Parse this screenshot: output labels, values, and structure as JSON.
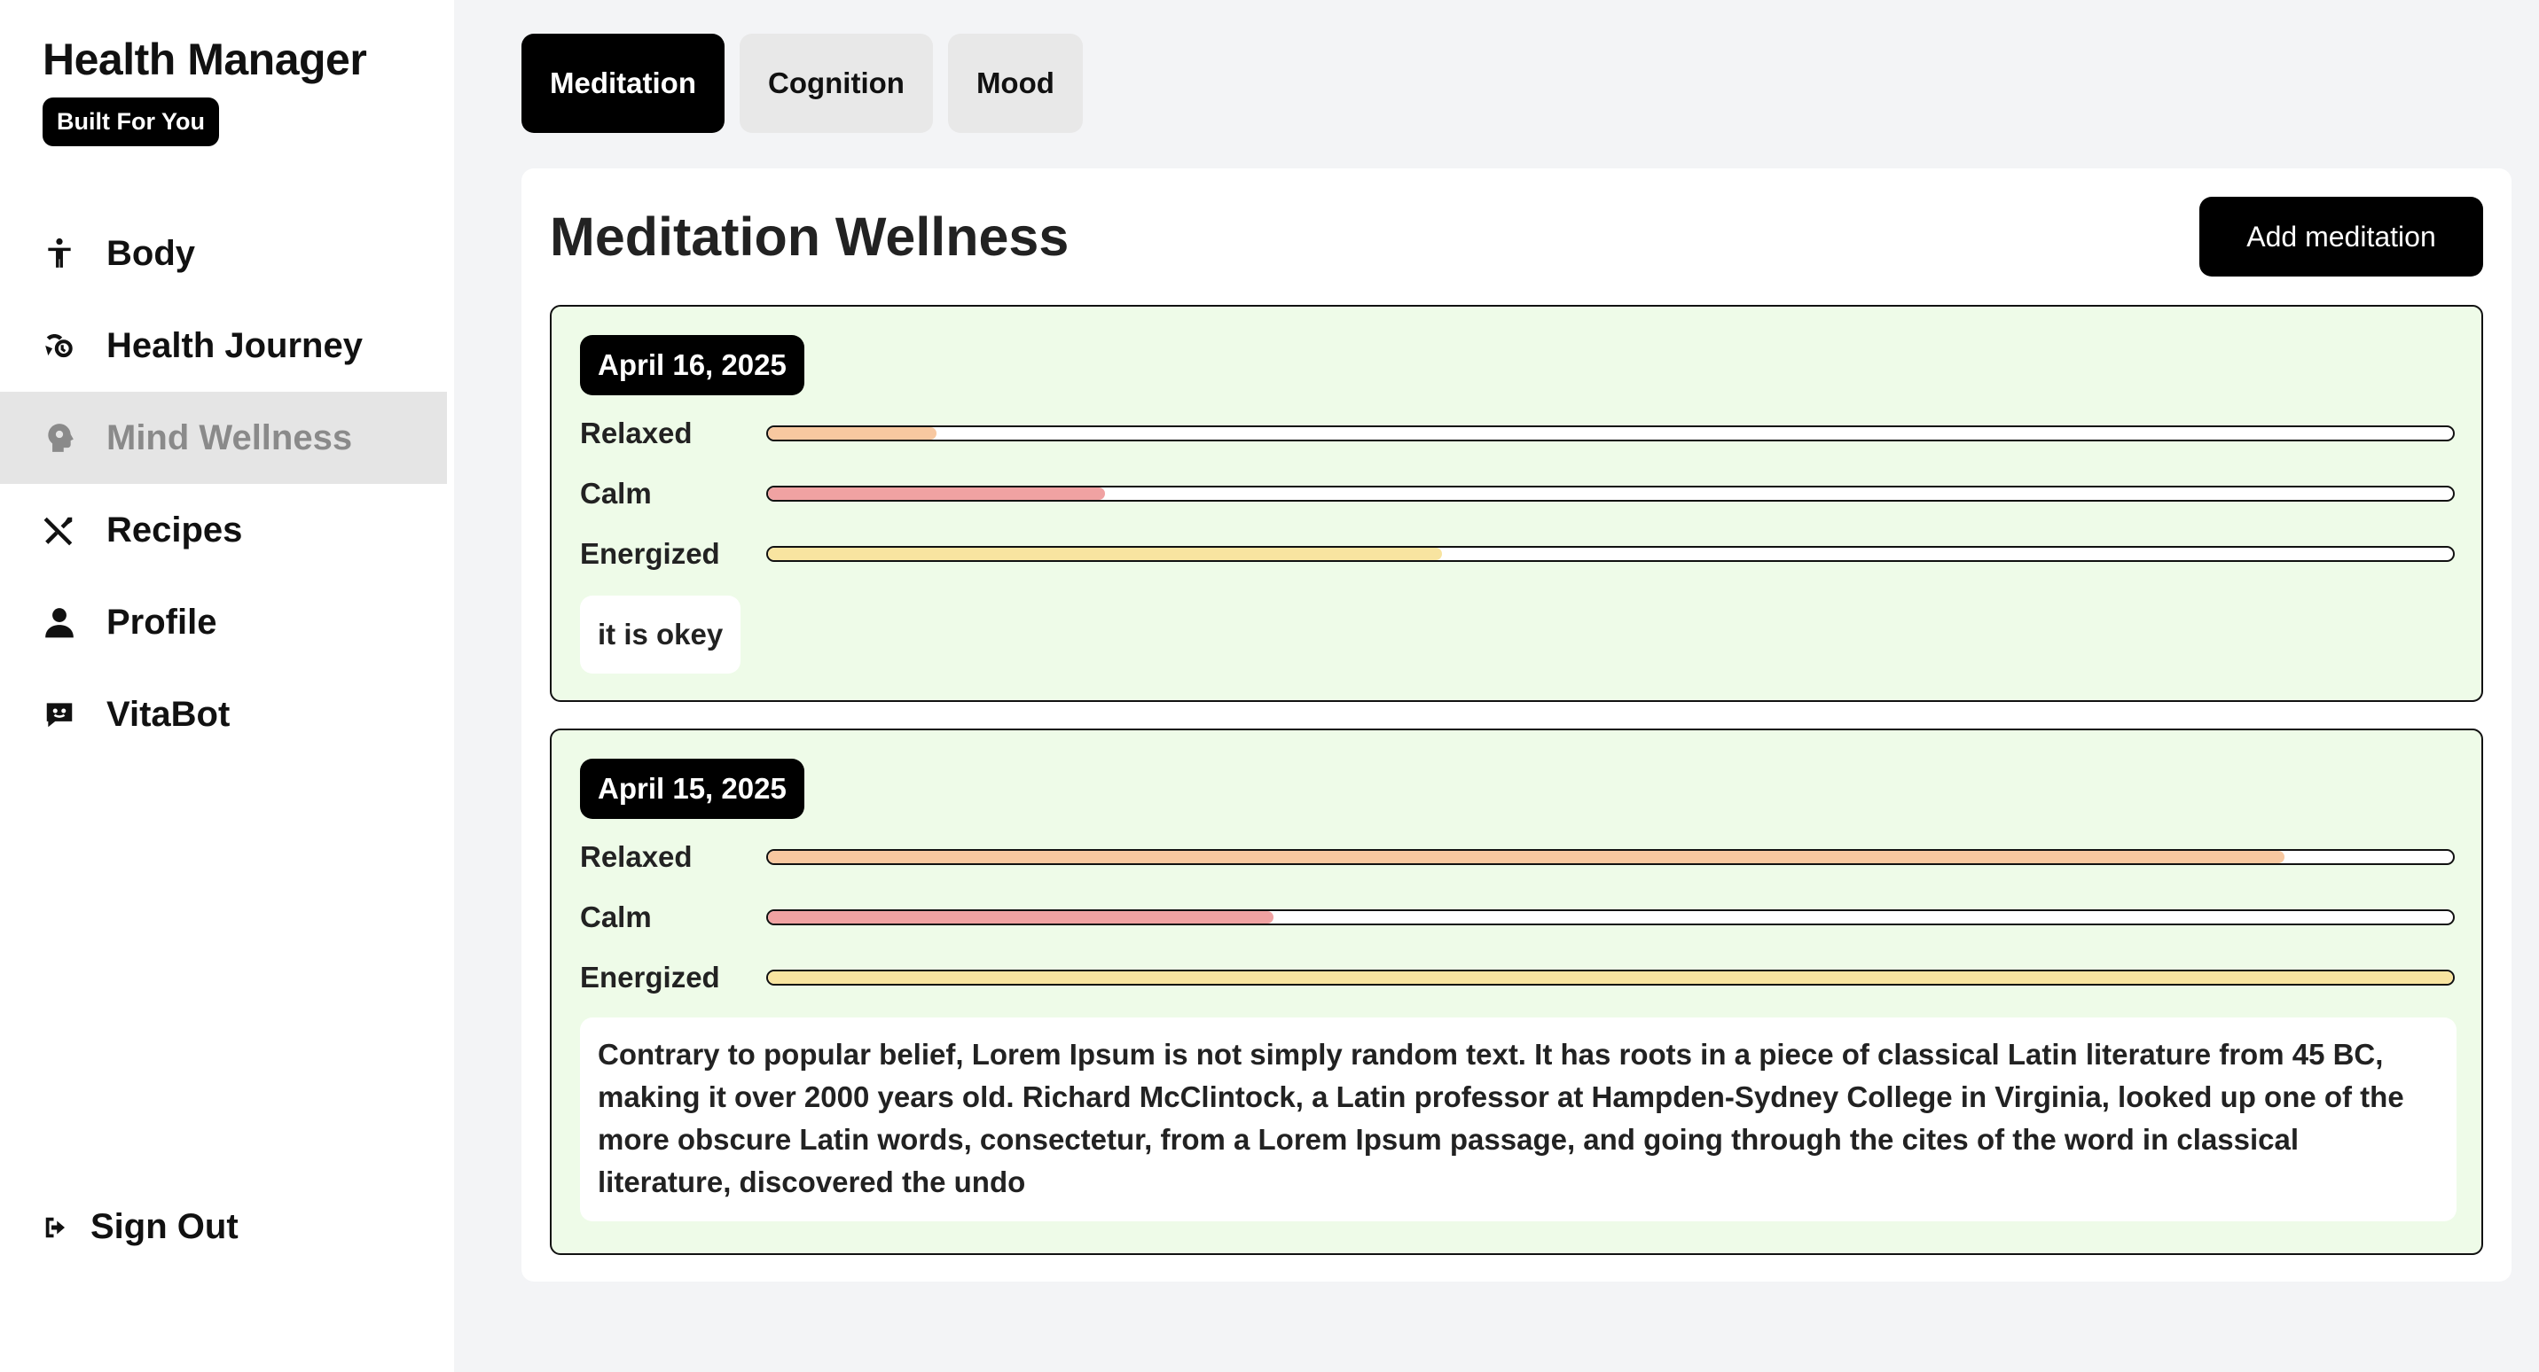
{
  "sidebar": {
    "title": "Health Manager",
    "badge": "Built For You",
    "items": [
      {
        "label": "Body",
        "icon": "person-icon"
      },
      {
        "label": "Health Journey",
        "icon": "journey-icon"
      },
      {
        "label": "Mind Wellness",
        "icon": "brain-icon",
        "active": true
      },
      {
        "label": "Recipes",
        "icon": "utensils-icon"
      },
      {
        "label": "Profile",
        "icon": "user-icon"
      },
      {
        "label": "VitaBot",
        "icon": "chatbot-icon"
      }
    ],
    "signout": "Sign Out"
  },
  "tabs": [
    {
      "label": "Meditation",
      "active": true
    },
    {
      "label": "Cognition"
    },
    {
      "label": "Mood"
    }
  ],
  "panel": {
    "title": "Meditation Wellness",
    "add_button": "Add meditation"
  },
  "metric_labels": {
    "relaxed": "Relaxed",
    "calm": "Calm",
    "energized": "Energized"
  },
  "colors": {
    "relaxed": "#f8c8a0",
    "calm": "#f0a2a2",
    "energized": "#f8e4a0",
    "entry_bg": "#eefbe8"
  },
  "entries": [
    {
      "date": "April 16, 2025",
      "relaxed": 0.1,
      "calm": 0.2,
      "energized": 0.4,
      "note": "it is okey"
    },
    {
      "date": "April 15, 2025",
      "relaxed": 0.9,
      "calm": 0.3,
      "energized": 1.0,
      "note": "Contrary to popular belief, Lorem Ipsum is not simply random text. It has roots in a piece of classical Latin literature from 45 BC, making it over 2000 years old. Richard McClintock, a Latin professor at Hampden-Sydney College in Virginia, looked up one of the more obscure Latin words, consectetur, from a Lorem Ipsum passage, and going through the cites of the word in classical literature, discovered the undo"
    }
  ]
}
